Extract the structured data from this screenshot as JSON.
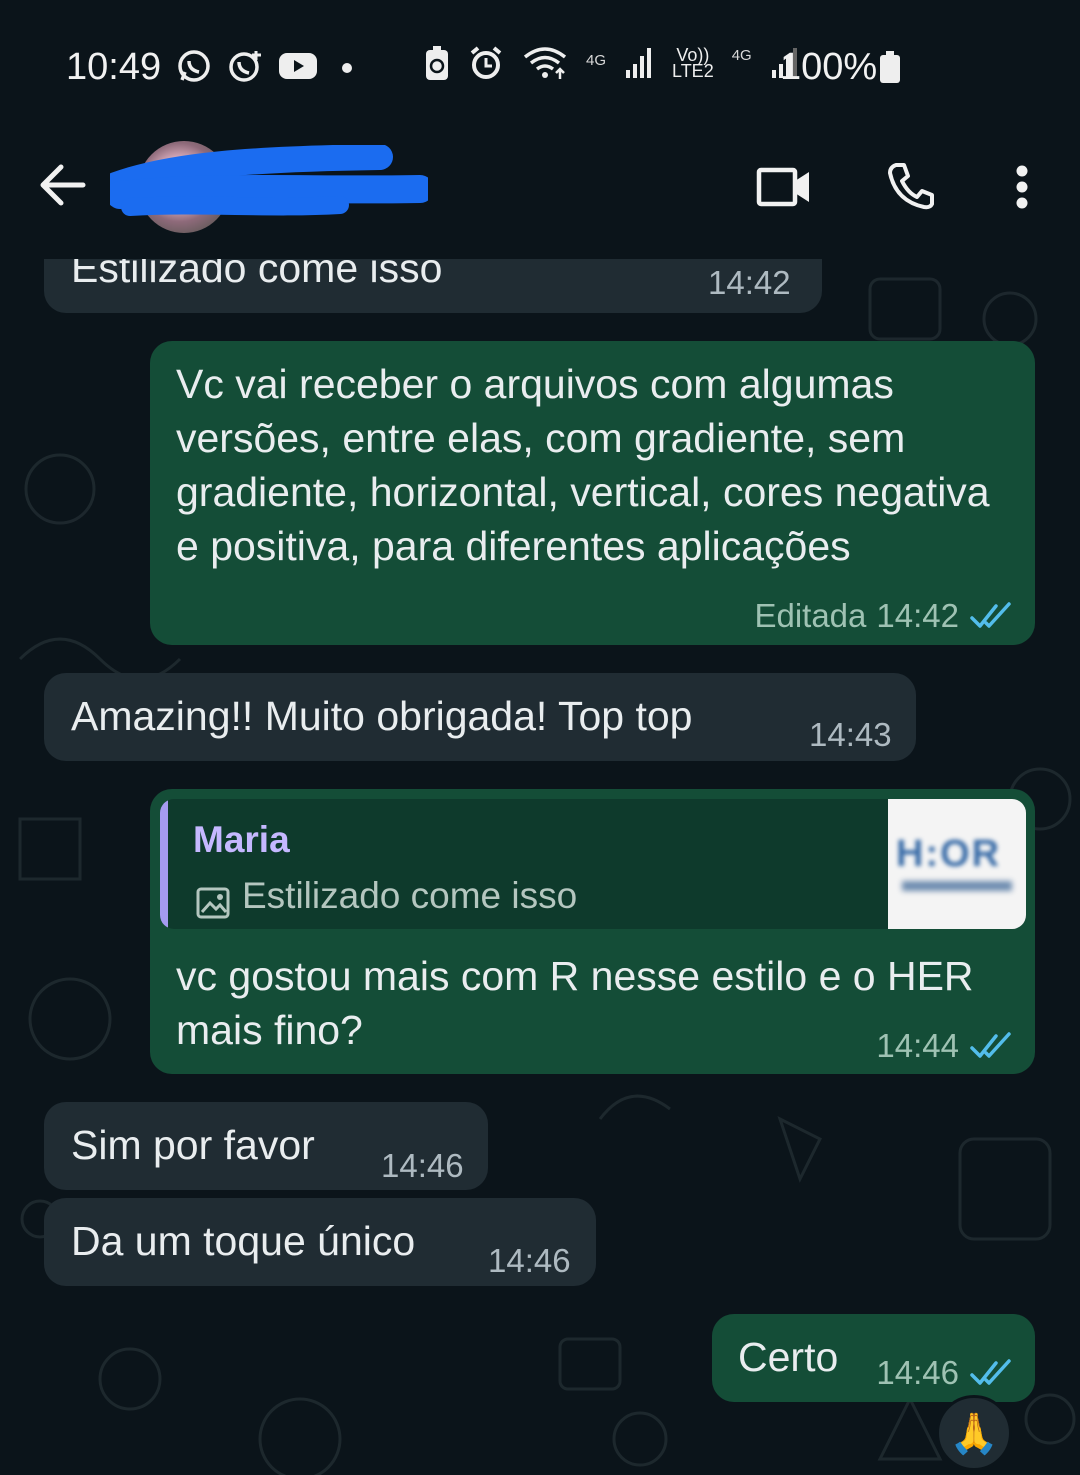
{
  "status_bar": {
    "time": "10:49",
    "network_left": "4G",
    "volte_top": "Vo))",
    "volte_bottom": "LTE2",
    "network_right": "4G",
    "battery": "100%",
    "icons": [
      "whatsapp-icon",
      "whatsapp-business-icon",
      "youtube-icon",
      "dot-icon",
      "battery-saver-icon",
      "alarm-icon",
      "wifi-icon",
      "signal-icon",
      "signal-icon",
      "battery-icon"
    ]
  },
  "header": {
    "icons": [
      "back-arrow-icon",
      "video-call-icon",
      "phone-icon",
      "more-vert-icon"
    ]
  },
  "messages": [
    {
      "id": "m1",
      "dir": "in",
      "text": "Estilizado come isso",
      "time": "14:42"
    },
    {
      "id": "m2",
      "dir": "out",
      "text": "Vc vai receber o arquivos com algumas versões, entre elas, com gradiente, sem gradiente, horizontal, vertical, cores negativa e positiva, para diferentes aplicações",
      "edited": "Editada",
      "time": "14:42",
      "status": "read"
    },
    {
      "id": "m3",
      "dir": "in",
      "text": "Amazing!! Muito obrigada! Top top",
      "time": "14:43"
    },
    {
      "id": "m4",
      "dir": "out",
      "quote_name": "Maria",
      "quote_text": "Estilizado come isso",
      "thumb_text": "H:OR",
      "text": "vc gostou mais com R nesse estilo e o HER mais fino?",
      "time": "14:44",
      "status": "read"
    },
    {
      "id": "m5",
      "dir": "in",
      "text": "Sim por favor",
      "time": "14:46"
    },
    {
      "id": "m6",
      "dir": "in",
      "text": "Da um toque único",
      "time": "14:46"
    },
    {
      "id": "m7",
      "dir": "out",
      "text": "Certo",
      "time": "14:46",
      "status": "read",
      "reaction": "🙏"
    }
  ]
}
